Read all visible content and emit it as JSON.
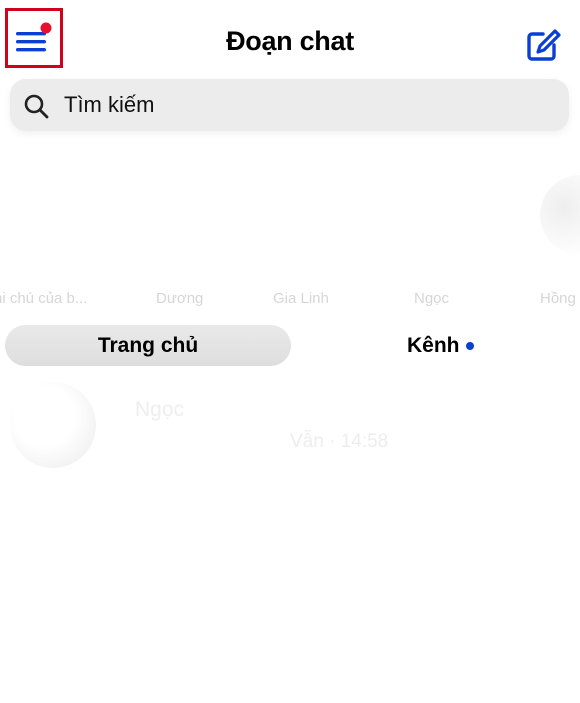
{
  "header": {
    "title": "Đoạn chat",
    "menu_icon": "hamburger-menu-icon",
    "notification_dot_color": "#e8112d",
    "compose_icon": "compose-icon",
    "accent_color": "#0a3fd6"
  },
  "search": {
    "placeholder": "Tìm kiếm",
    "icon": "search-icon"
  },
  "stories": [
    {
      "name": "hi chú của b..."
    },
    {
      "name": "Dương"
    },
    {
      "name": "Gia Linh"
    },
    {
      "name": "Ngọc"
    },
    {
      "name": "Hồng"
    }
  ],
  "tabs": [
    {
      "label": "Trang chủ",
      "selected": true
    },
    {
      "label": "Kênh",
      "has_unread_dot": true
    }
  ],
  "conversations": [
    {
      "name": "Ngọc",
      "preview": "Vẫn · 14:58"
    }
  ]
}
